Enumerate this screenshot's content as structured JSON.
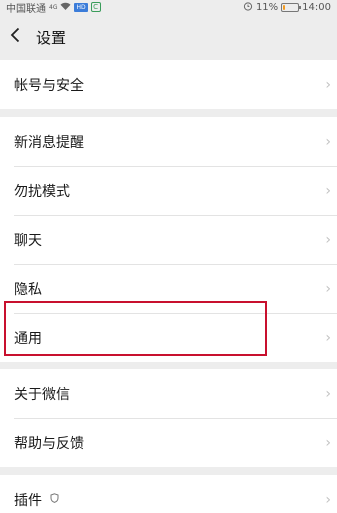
{
  "status_bar": {
    "carrier": "中国联通",
    "signal_label": "4G",
    "hd_badge": "HD",
    "app_badge": "C",
    "battery_percent": "11%",
    "battery_level": 0.11,
    "time": "14:00"
  },
  "nav": {
    "title": "设置"
  },
  "groups": [
    {
      "items": [
        {
          "label": "帐号与安全"
        }
      ]
    },
    {
      "items": [
        {
          "label": "新消息提醒"
        },
        {
          "label": "勿扰模式"
        },
        {
          "label": "聊天"
        },
        {
          "label": "隐私"
        },
        {
          "label": "通用"
        }
      ]
    },
    {
      "items": [
        {
          "label": "关于微信"
        },
        {
          "label": "帮助与反馈"
        }
      ]
    },
    {
      "items": [
        {
          "label": "插件"
        }
      ]
    }
  ],
  "colors": {
    "background": "#ededed",
    "highlight": "#c8102e",
    "battery": "#f39a1f"
  }
}
